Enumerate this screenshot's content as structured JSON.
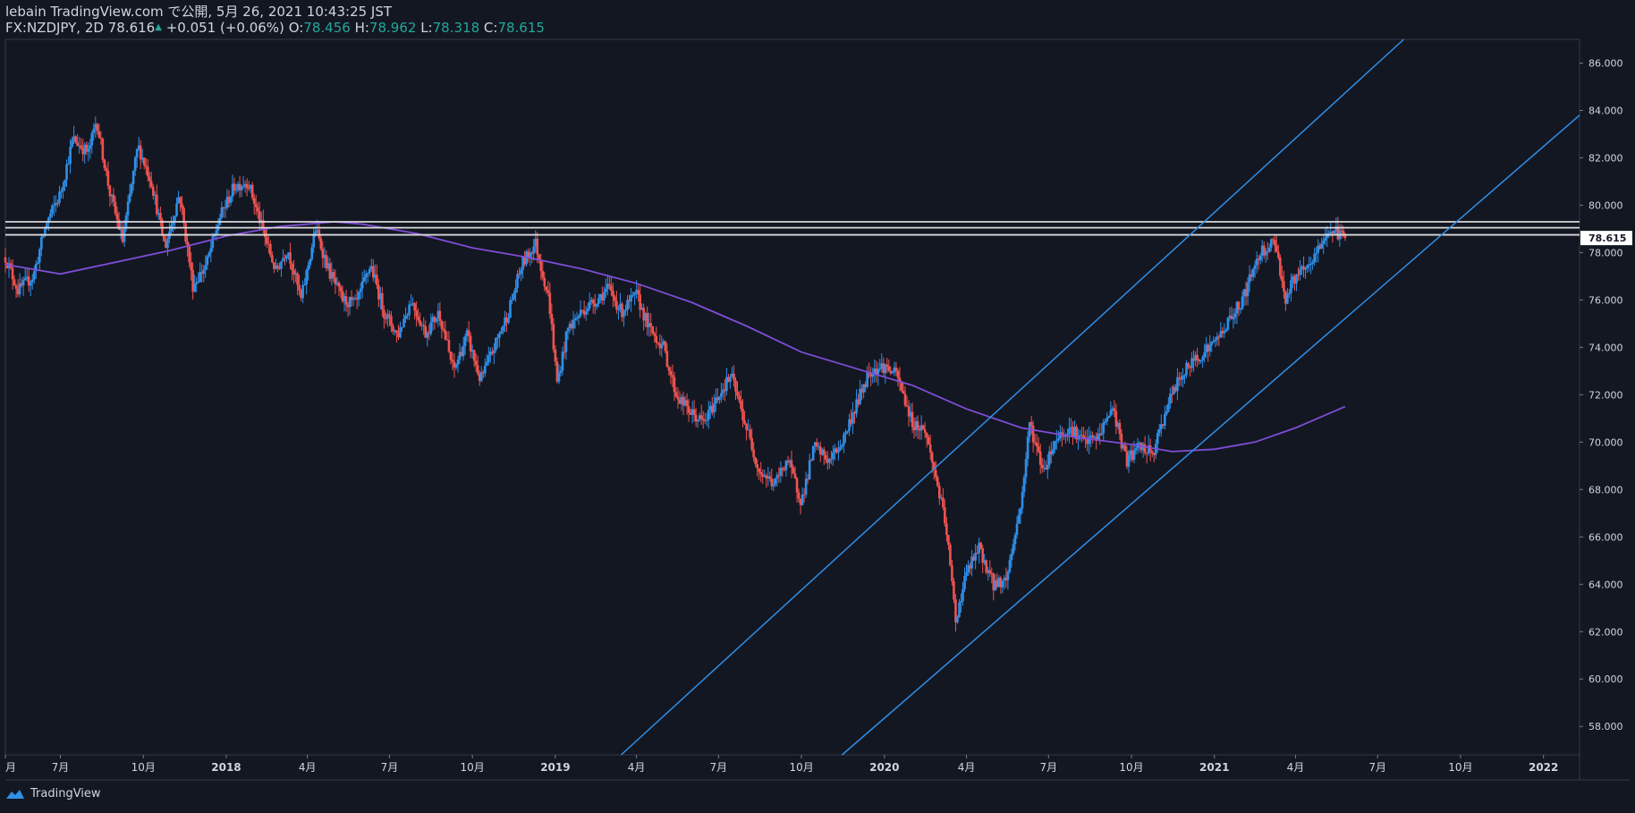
{
  "header": {
    "published": "lebain TradingView.com で公開, 5月 26, 2021 10:43:25 JST",
    "symbol": "FX:NZDJPY, 2D",
    "last": "78.616",
    "change": "+0.051 (+0.06%)",
    "o_label": "O:",
    "o_value": "78.456",
    "h_label": "H:",
    "h_value": "78.962",
    "l_label": "L:",
    "l_value": "78.318",
    "c_label": "C:",
    "c_value": "78.615"
  },
  "footer": {
    "brand": "TradingView"
  },
  "colors": {
    "background": "#131722",
    "up": "#2f8fe8",
    "down": "#ef5350",
    "ma": "#7e4dd6",
    "trendline": "#2f8fe8",
    "resistance": "#d9d9d9",
    "price_tag": "#ffffff"
  },
  "chart_data": {
    "type": "candlestick",
    "symbol": "FX:NZDJPY",
    "interval": "2D",
    "x_range": [
      "2017-05-01",
      "2022-02-10"
    ],
    "y_range": [
      56.8,
      87.0
    ],
    "y_ticks": [
      "86.000",
      "84.000",
      "82.000",
      "80.000",
      "78.000",
      "76.000",
      "74.000",
      "72.000",
      "70.000",
      "68.000",
      "66.000",
      "64.000",
      "62.000",
      "60.000",
      "58.000"
    ],
    "x_ticks": [
      {
        "date": "2017-05-01",
        "label": "月"
      },
      {
        "date": "2017-07-01",
        "label": "7月"
      },
      {
        "date": "2017-10-01",
        "label": "10月"
      },
      {
        "date": "2018-01-01",
        "label": "2018"
      },
      {
        "date": "2018-04-01",
        "label": "4月"
      },
      {
        "date": "2018-07-01",
        "label": "7月"
      },
      {
        "date": "2018-10-01",
        "label": "10月"
      },
      {
        "date": "2019-01-01",
        "label": "2019"
      },
      {
        "date": "2019-04-01",
        "label": "4月"
      },
      {
        "date": "2019-07-01",
        "label": "7月"
      },
      {
        "date": "2019-10-01",
        "label": "10月"
      },
      {
        "date": "2020-01-01",
        "label": "2020"
      },
      {
        "date": "2020-04-01",
        "label": "4月"
      },
      {
        "date": "2020-07-01",
        "label": "7月"
      },
      {
        "date": "2020-10-01",
        "label": "10月"
      },
      {
        "date": "2021-01-01",
        "label": "2021"
      },
      {
        "date": "2021-04-01",
        "label": "4月"
      },
      {
        "date": "2021-07-01",
        "label": "7月"
      },
      {
        "date": "2021-10-01",
        "label": "10月"
      },
      {
        "date": "2022-01-01",
        "label": "2022"
      }
    ],
    "last_price_label": "78.615",
    "last_price": 78.615,
    "price_path": [
      [
        "2017-05-01",
        77.8
      ],
      [
        "2017-05-15",
        76.4
      ],
      [
        "2017-06-01",
        77.0
      ],
      [
        "2017-06-15",
        79.2
      ],
      [
        "2017-07-01",
        80.5
      ],
      [
        "2017-07-15",
        82.8
      ],
      [
        "2017-08-01",
        82.2
      ],
      [
        "2017-08-10",
        83.6
      ],
      [
        "2017-08-25",
        80.5
      ],
      [
        "2017-09-08",
        78.5
      ],
      [
        "2017-09-25",
        82.5
      ],
      [
        "2017-10-10",
        81.0
      ],
      [
        "2017-10-25",
        78.2
      ],
      [
        "2017-11-10",
        80.5
      ],
      [
        "2017-11-25",
        76.6
      ],
      [
        "2017-12-10",
        77.5
      ],
      [
        "2017-12-25",
        79.5
      ],
      [
        "2018-01-10",
        80.8
      ],
      [
        "2018-01-25",
        81.0
      ],
      [
        "2018-02-10",
        79.0
      ],
      [
        "2018-02-25",
        77.2
      ],
      [
        "2018-03-10",
        78.2
      ],
      [
        "2018-03-25",
        76.0
      ],
      [
        "2018-04-10",
        79.0
      ],
      [
        "2018-04-25",
        77.2
      ],
      [
        "2018-05-10",
        76.0
      ],
      [
        "2018-05-25",
        75.8
      ],
      [
        "2018-06-10",
        77.5
      ],
      [
        "2018-06-25",
        75.5
      ],
      [
        "2018-07-10",
        74.5
      ],
      [
        "2018-07-25",
        76.0
      ],
      [
        "2018-08-10",
        74.6
      ],
      [
        "2018-08-25",
        75.5
      ],
      [
        "2018-09-10",
        73.0
      ],
      [
        "2018-09-25",
        74.5
      ],
      [
        "2018-10-10",
        72.6
      ],
      [
        "2018-10-25",
        74.0
      ],
      [
        "2018-11-10",
        75.5
      ],
      [
        "2018-11-25",
        77.5
      ],
      [
        "2018-12-10",
        78.4
      ],
      [
        "2018-12-25",
        76.0
      ],
      [
        "2019-01-03",
        72.5
      ],
      [
        "2019-01-15",
        74.8
      ],
      [
        "2019-02-01",
        75.6
      ],
      [
        "2019-02-15",
        76.0
      ],
      [
        "2019-03-01",
        76.5
      ],
      [
        "2019-03-15",
        75.5
      ],
      [
        "2019-04-01",
        76.2
      ],
      [
        "2019-04-15",
        74.8
      ],
      [
        "2019-05-01",
        74.0
      ],
      [
        "2019-05-15",
        72.0
      ],
      [
        "2019-06-01",
        71.2
      ],
      [
        "2019-06-15",
        70.8
      ],
      [
        "2019-07-01",
        72.0
      ],
      [
        "2019-07-15",
        72.8
      ],
      [
        "2019-08-01",
        70.6
      ],
      [
        "2019-08-15",
        68.8
      ],
      [
        "2019-09-01",
        68.2
      ],
      [
        "2019-09-15",
        69.3
      ],
      [
        "2019-10-01",
        67.5
      ],
      [
        "2019-10-15",
        69.8
      ],
      [
        "2019-11-01",
        69.2
      ],
      [
        "2019-11-15",
        70.0
      ],
      [
        "2019-12-01",
        71.6
      ],
      [
        "2019-12-15",
        73.0
      ],
      [
        "2020-01-01",
        73.2
      ],
      [
        "2020-01-15",
        72.8
      ],
      [
        "2020-02-01",
        70.8
      ],
      [
        "2020-02-15",
        70.5
      ],
      [
        "2020-03-01",
        68.0
      ],
      [
        "2020-03-10",
        66.2
      ],
      [
        "2020-03-20",
        62.5
      ],
      [
        "2020-04-01",
        64.5
      ],
      [
        "2020-04-15",
        65.5
      ],
      [
        "2020-05-01",
        64.0
      ],
      [
        "2020-05-15",
        64.2
      ],
      [
        "2020-06-01",
        67.5
      ],
      [
        "2020-06-10",
        70.8
      ],
      [
        "2020-06-25",
        68.8
      ],
      [
        "2020-07-10",
        70.2
      ],
      [
        "2020-07-25",
        70.6
      ],
      [
        "2020-08-10",
        70.0
      ],
      [
        "2020-08-25",
        70.2
      ],
      [
        "2020-09-10",
        71.5
      ],
      [
        "2020-09-25",
        69.2
      ],
      [
        "2020-10-10",
        69.8
      ],
      [
        "2020-10-25",
        69.5
      ],
      [
        "2020-11-10",
        71.6
      ],
      [
        "2020-11-25",
        72.8
      ],
      [
        "2020-12-10",
        73.5
      ],
      [
        "2021-01-01",
        74.2
      ],
      [
        "2021-01-15",
        75.0
      ],
      [
        "2021-02-01",
        76.0
      ],
      [
        "2021-02-20",
        78.0
      ],
      [
        "2021-03-10",
        78.5
      ],
      [
        "2021-03-20",
        76.0
      ],
      [
        "2021-04-01",
        77.0
      ],
      [
        "2021-04-15",
        77.3
      ],
      [
        "2021-05-01",
        78.5
      ],
      [
        "2021-05-10",
        79.0
      ],
      [
        "2021-05-26",
        78.615
      ]
    ],
    "moving_average": [
      [
        "2017-05-01",
        77.5
      ],
      [
        "2017-07-01",
        77.1
      ],
      [
        "2017-09-01",
        77.6
      ],
      [
        "2017-11-01",
        78.1
      ],
      [
        "2018-01-01",
        78.7
      ],
      [
        "2018-03-01",
        79.1
      ],
      [
        "2018-05-01",
        79.3
      ],
      [
        "2018-06-01",
        79.2
      ],
      [
        "2018-08-01",
        78.8
      ],
      [
        "2018-10-01",
        78.2
      ],
      [
        "2018-12-01",
        77.8
      ],
      [
        "2019-02-01",
        77.3
      ],
      [
        "2019-04-01",
        76.7
      ],
      [
        "2019-06-01",
        75.9
      ],
      [
        "2019-08-01",
        74.9
      ],
      [
        "2019-10-01",
        73.8
      ],
      [
        "2019-12-01",
        73.1
      ],
      [
        "2020-02-01",
        72.4
      ],
      [
        "2020-04-01",
        71.4
      ],
      [
        "2020-06-01",
        70.6
      ],
      [
        "2020-08-01",
        70.2
      ],
      [
        "2020-10-01",
        69.9
      ],
      [
        "2020-11-15",
        69.6
      ],
      [
        "2021-01-01",
        69.7
      ],
      [
        "2021-02-15",
        70.0
      ],
      [
        "2021-04-01",
        70.6
      ],
      [
        "2021-05-26",
        71.5
      ]
    ],
    "trendlines": [
      {
        "from": [
          "2019-03-15",
          56.8
        ],
        "to": [
          "2021-07-30",
          87.0
        ]
      },
      {
        "from": [
          "2019-11-15",
          56.8
        ],
        "to": [
          "2022-02-10",
          83.8
        ]
      }
    ],
    "horizontal_lines": [
      79.3,
      79.05,
      78.75
    ]
  }
}
